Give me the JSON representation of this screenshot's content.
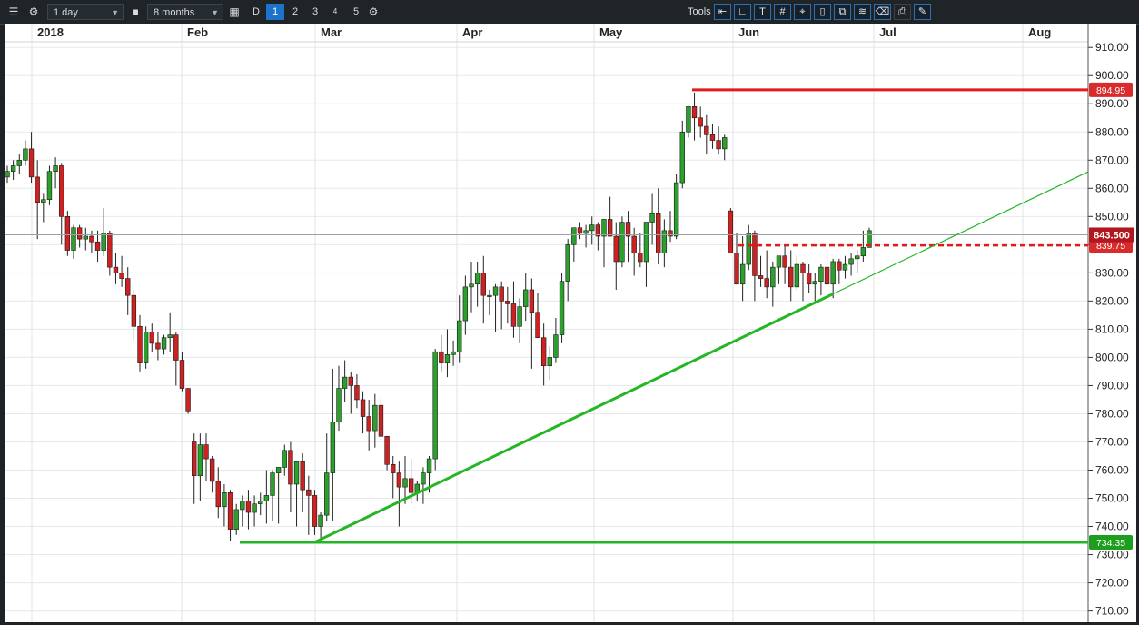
{
  "toolbar": {
    "menu_icon": "list-icon",
    "settings_icon": "gear-icon",
    "interval_select": "1 day",
    "lock_icon": "lock-icon",
    "range_select": "8 months",
    "calendar_icon": "calendar-icon",
    "period_d": "D",
    "period_buttons": [
      "1",
      "2",
      "3",
      "4",
      "5"
    ],
    "tools_label": "Tools",
    "tool_icons": [
      "back-arrow-icon",
      "curve-icon",
      "text-tool-icon",
      "grid-icon",
      "crosshair-icon",
      "marker-icon",
      "copy-icon",
      "line-tools-icon",
      "eraser-icon",
      "print-icon",
      "tool-settings-icon"
    ]
  },
  "chart_data": {
    "type": "candlestick",
    "x_labels": [
      "2018",
      "Feb",
      "Mar",
      "Apr",
      "May",
      "Jun",
      "Jul",
      "Aug"
    ],
    "y_ticks": [
      710,
      720,
      730,
      740,
      750,
      760,
      770,
      780,
      790,
      800,
      810,
      820,
      830,
      840,
      850,
      860,
      870,
      880,
      890,
      900,
      910
    ],
    "ylim": [
      706,
      912
    ],
    "last_price": "843.500",
    "resistance_label": "894.95",
    "resistance": 894.95,
    "support_label": "734.35",
    "support": 734.35,
    "dashed_label": "839.75",
    "dashed_level": 839.75,
    "trendline": {
      "start": [
        "Mar",
        734.35
      ],
      "end": [
        "Jun",
        822.5
      ]
    },
    "colors": {
      "up": "#2ca02c",
      "down": "#cc2222",
      "resistance": "#e01b1b",
      "support": "#25b625",
      "last": "#b3161c"
    },
    "grid": true,
    "candles": [
      [
        864,
        868,
        862,
        866
      ],
      [
        866,
        870,
        863,
        868
      ],
      [
        868,
        872,
        865,
        870
      ],
      [
        870,
        877,
        868,
        874
      ],
      [
        874,
        880,
        862,
        864
      ],
      [
        864,
        870,
        842,
        855
      ],
      [
        855,
        858,
        848,
        856
      ],
      [
        856,
        868,
        854,
        866
      ],
      [
        866,
        871,
        860,
        868
      ],
      [
        868,
        869,
        840,
        850
      ],
      [
        850,
        852,
        836,
        838
      ],
      [
        838,
        847,
        835,
        846
      ],
      [
        846,
        847,
        839,
        842
      ],
      [
        842,
        846,
        838,
        843
      ],
      [
        843,
        845,
        837,
        841
      ],
      [
        841,
        845,
        834,
        838
      ],
      [
        838,
        853,
        836,
        844
      ],
      [
        844,
        845,
        829,
        832
      ],
      [
        832,
        837,
        826,
        830
      ],
      [
        830,
        836,
        825,
        828
      ],
      [
        828,
        832,
        815,
        822
      ],
      [
        822,
        824,
        806,
        811
      ],
      [
        811,
        815,
        795,
        798
      ],
      [
        798,
        811,
        796,
        809
      ],
      [
        809,
        812,
        802,
        805
      ],
      [
        805,
        809,
        799,
        803
      ],
      [
        803,
        808,
        801,
        807
      ],
      [
        807,
        816,
        802,
        808
      ],
      [
        808,
        809,
        790,
        799
      ],
      [
        799,
        802,
        788,
        789
      ],
      [
        789,
        786,
        780,
        781
      ],
      [
        770,
        773,
        748,
        758
      ],
      [
        758,
        773,
        749,
        769
      ],
      [
        769,
        773,
        756,
        764
      ],
      [
        764,
        765,
        752,
        756
      ],
      [
        756,
        761,
        743,
        747
      ],
      [
        747,
        755,
        740,
        752
      ],
      [
        752,
        753,
        735,
        739
      ],
      [
        739,
        748,
        737,
        746
      ],
      [
        746,
        751,
        740,
        749
      ],
      [
        749,
        753,
        739,
        745
      ],
      [
        745,
        751,
        740,
        748
      ],
      [
        748,
        752,
        744,
        749
      ],
      [
        749,
        760,
        741,
        751
      ],
      [
        751,
        760,
        742,
        759
      ],
      [
        759,
        761,
        741,
        761
      ],
      [
        761,
        769,
        758,
        767
      ],
      [
        767,
        770,
        745,
        755
      ],
      [
        755,
        762,
        740,
        763
      ],
      [
        763,
        766,
        745,
        753
      ],
      [
        753,
        758,
        737,
        751
      ],
      [
        751,
        753,
        737,
        740
      ],
      [
        740,
        745,
        735,
        744
      ],
      [
        744,
        773,
        742,
        759
      ],
      [
        759,
        796,
        742,
        777
      ],
      [
        777,
        797,
        774,
        789
      ],
      [
        789,
        799,
        784,
        793
      ],
      [
        793,
        795,
        780,
        790
      ],
      [
        790,
        794,
        782,
        785
      ],
      [
        785,
        788,
        773,
        779
      ],
      [
        779,
        785,
        767,
        774
      ],
      [
        774,
        787,
        768,
        783
      ],
      [
        783,
        786,
        770,
        772
      ],
      [
        772,
        769,
        760,
        762
      ],
      [
        762,
        765,
        750,
        759
      ],
      [
        759,
        763,
        740,
        754
      ],
      [
        754,
        765,
        748,
        757
      ],
      [
        757,
        764,
        748,
        752
      ],
      [
        752,
        756,
        749,
        755
      ],
      [
        755,
        761,
        748,
        759
      ],
      [
        759,
        765,
        752,
        764
      ],
      [
        764,
        803,
        760,
        802
      ],
      [
        802,
        808,
        795,
        798
      ],
      [
        798,
        810,
        793,
        801
      ],
      [
        801,
        806,
        797,
        802
      ],
      [
        802,
        822,
        798,
        813
      ],
      [
        813,
        829,
        808,
        825
      ],
      [
        825,
        834,
        816,
        826
      ],
      [
        826,
        834,
        818,
        830
      ],
      [
        830,
        836,
        812,
        822
      ],
      [
        822,
        824,
        815,
        822
      ],
      [
        822,
        826,
        809,
        825
      ],
      [
        825,
        827,
        810,
        820
      ],
      [
        820,
        825,
        812,
        819
      ],
      [
        819,
        827,
        807,
        811
      ],
      [
        811,
        821,
        805,
        818
      ],
      [
        818,
        830,
        813,
        824
      ],
      [
        824,
        828,
        796,
        816
      ],
      [
        816,
        823,
        808,
        807
      ],
      [
        807,
        812,
        790,
        797
      ],
      [
        797,
        804,
        792,
        800
      ],
      [
        800,
        814,
        798,
        808
      ],
      [
        808,
        830,
        805,
        827
      ],
      [
        827,
        842,
        820,
        840
      ],
      [
        840,
        845,
        834,
        846
      ],
      [
        846,
        848,
        842,
        844
      ],
      [
        844,
        847,
        839,
        845
      ],
      [
        845,
        850,
        840,
        847
      ],
      [
        847,
        848,
        838,
        843
      ],
      [
        843,
        846,
        832,
        849
      ],
      [
        849,
        857,
        845,
        843
      ],
      [
        843,
        848,
        824,
        834
      ],
      [
        834,
        850,
        832,
        848
      ],
      [
        848,
        852,
        834,
        843
      ],
      [
        843,
        846,
        829,
        837
      ],
      [
        837,
        844,
        832,
        834
      ],
      [
        834,
        843,
        825,
        848
      ],
      [
        848,
        858,
        840,
        851
      ],
      [
        851,
        860,
        833,
        837
      ],
      [
        837,
        849,
        832,
        845
      ],
      [
        845,
        852,
        841,
        843
      ],
      [
        843,
        865,
        842,
        862
      ],
      [
        862,
        884,
        860,
        880
      ],
      [
        880,
        887,
        878,
        889
      ],
      [
        889,
        894,
        877,
        885
      ],
      [
        885,
        889,
        878,
        882
      ],
      [
        882,
        886,
        872,
        879
      ],
      [
        879,
        883,
        874,
        877
      ],
      [
        877,
        882,
        872,
        874
      ],
      [
        874,
        879,
        870,
        878
      ],
      [
        852,
        853,
        837,
        837
      ],
      [
        837,
        844,
        826,
        826
      ],
      [
        826,
        843,
        820,
        833
      ],
      [
        833,
        847,
        831,
        844
      ],
      [
        844,
        845,
        820,
        829
      ],
      [
        829,
        836,
        825,
        828
      ],
      [
        828,
        838,
        821,
        825
      ],
      [
        825,
        834,
        818,
        832
      ],
      [
        832,
        834,
        826,
        836
      ],
      [
        836,
        840,
        826,
        832
      ],
      [
        832,
        838,
        820,
        825
      ],
      [
        825,
        836,
        824,
        833
      ],
      [
        833,
        834,
        820,
        830
      ],
      [
        830,
        833,
        823,
        826
      ],
      [
        826,
        830,
        820,
        827
      ],
      [
        827,
        833,
        822,
        832
      ],
      [
        832,
        838,
        826,
        826
      ],
      [
        826,
        835,
        821,
        834
      ],
      [
        834,
        835,
        826,
        831
      ],
      [
        831,
        836,
        828,
        833
      ],
      [
        833,
        837,
        829,
        835
      ],
      [
        835,
        838,
        830,
        836
      ],
      [
        836,
        845,
        834,
        839
      ],
      [
        839,
        846,
        840,
        845
      ]
    ]
  }
}
